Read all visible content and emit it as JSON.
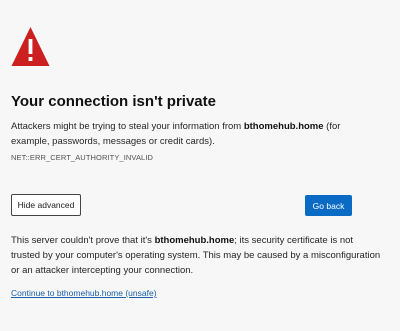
{
  "heading": "Your connection isn't private",
  "description": {
    "before": "Attackers might be trying to steal your information from ",
    "host": "bthomehub.home",
    "after": " (for example, passwords, messages or credit cards)."
  },
  "error_code": "NET::ERR_CERT_AUTHORITY_INVALID",
  "buttons": {
    "hide_advanced": "Hide advanced",
    "go_back": "Go back"
  },
  "advanced": {
    "before": "This server couldn't prove that it's ",
    "host": "bthomehub.home",
    "after": "; its security certificate is not trusted by your computer's operating system. This may be caused by a misconfiguration or an attacker intercepting your connection."
  },
  "proceed_link": "Continue to bthomehub.home (unsafe)",
  "icons": {
    "warning": "warning-triangle-icon"
  },
  "colors": {
    "warning": "#cc1f1f",
    "primary_button": "#0a6bc4",
    "link": "#1a5fa8",
    "background": "#f7f7f7"
  }
}
